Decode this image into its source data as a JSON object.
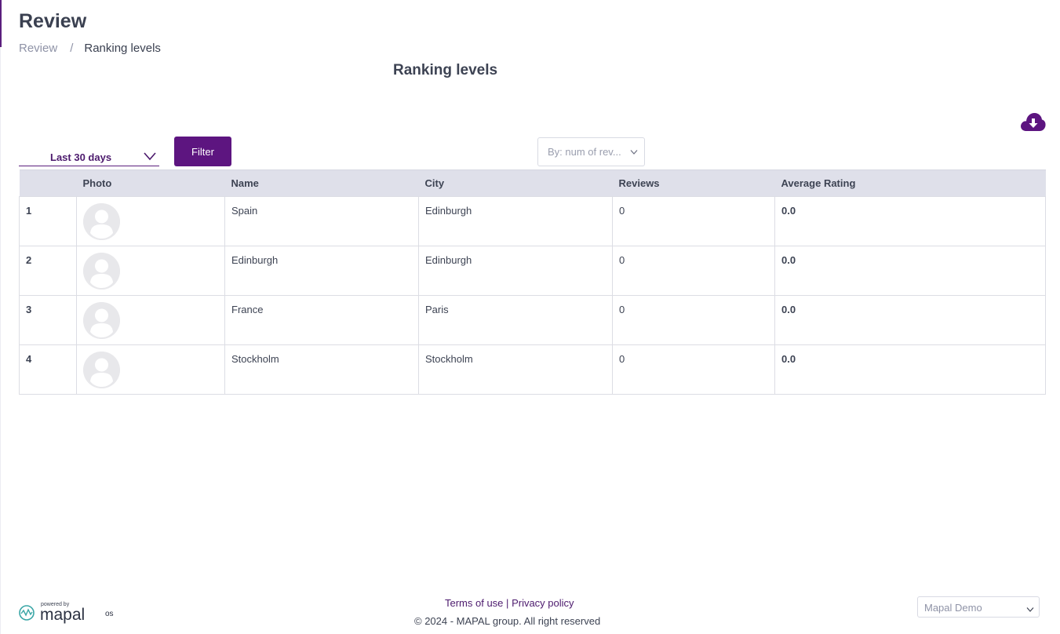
{
  "header": {
    "title": "Review",
    "breadcrumb": {
      "parent": "Review",
      "separator": "/",
      "current": "Ranking levels"
    }
  },
  "main": {
    "section_title": "Ranking levels",
    "download_icon": "cloud-download-icon",
    "date_range": {
      "selected": "Last 30 days"
    },
    "filter_label": "Filter",
    "sort": {
      "selected": "By: num of rev..."
    },
    "table": {
      "columns": [
        "",
        "Photo",
        "Name",
        "City",
        "Reviews",
        "Average Rating"
      ],
      "rows": [
        {
          "rank": "1",
          "name": "Spain",
          "city": "Edinburgh",
          "reviews": "0",
          "rating": "0.0"
        },
        {
          "rank": "2",
          "name": "Edinburgh",
          "city": "Edinburgh",
          "reviews": "0",
          "rating": "0.0"
        },
        {
          "rank": "3",
          "name": "France",
          "city": "Paris",
          "reviews": "0",
          "rating": "0.0"
        },
        {
          "rank": "4",
          "name": "Stockholm",
          "city": "Stockholm",
          "reviews": "0",
          "rating": "0.0"
        }
      ]
    }
  },
  "footer": {
    "logo": {
      "powered_by": "powered by",
      "brand": "mapal",
      "suffix": "os"
    },
    "terms": "Terms of use",
    "links_separator": "|",
    "privacy": "Privacy policy",
    "copyright": "© 2024 - MAPAL group. All right reserved",
    "account_select": "Mapal Demo"
  },
  "colors": {
    "accent": "#5d1580",
    "header_bg": "#dfe0ea",
    "text": "#3d4353",
    "muted": "#8f93a7"
  }
}
